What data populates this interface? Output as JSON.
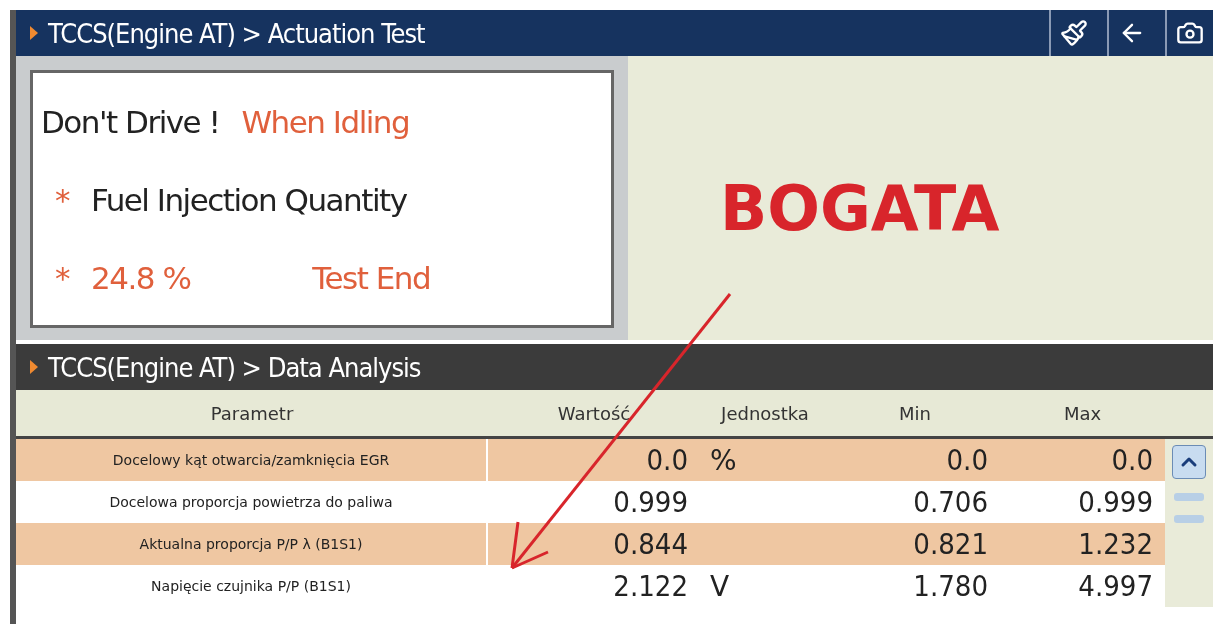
{
  "actuation": {
    "title": "TCCS(Engine AT) > Actuation Test",
    "warning": "Don't Drive !",
    "condition": "When Idling",
    "items": [
      {
        "bullet": "*",
        "label": "Fuel Injection Quantity"
      },
      {
        "bullet": "*",
        "label": "24.8 %",
        "status": "Test End"
      }
    ]
  },
  "annotation": {
    "text": "BOGATA"
  },
  "analysis": {
    "title": "TCCS(Engine AT) > Data Analysis",
    "columns": [
      "Parametr",
      "Wartość",
      "Jednostka",
      "Min",
      "Max"
    ],
    "rows": [
      {
        "parameter": "Docelowy kąt otwarcia/zamknięcia EGR",
        "value": "0.0",
        "unit": "%",
        "min": "0.0",
        "max": "0.0"
      },
      {
        "parameter": "Docelowa proporcja powietrza do paliwa",
        "value": "0.999",
        "min": "0.706",
        "max": "0.999"
      },
      {
        "parameter": "Aktualna proporcja P/P λ (B1S1)",
        "value": "0.844",
        "min": "0.821",
        "max": "1.232"
      },
      {
        "parameter": "Napięcie czujnika P/P (B1S1)",
        "value": "2.122",
        "unit": "V",
        "min": "1.780",
        "max": "4.997"
      }
    ]
  }
}
